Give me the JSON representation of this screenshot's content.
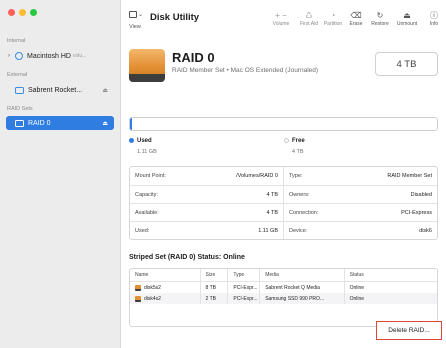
{
  "sidebar": {
    "sections": {
      "internal": "Internal",
      "external": "External",
      "raid_sets": "RAID Sets"
    },
    "items": [
      {
        "label": "Macintosh HD",
        "sub": "volu..."
      },
      {
        "label": "Sabrent Rocket...",
        "eject": "⏏"
      },
      {
        "label": "RAID 0",
        "eject": "⏏"
      }
    ]
  },
  "toolbar": {
    "view_label": "View",
    "title": "Disk Utility",
    "buttons": [
      {
        "icon": "+  −",
        "label": "Volume"
      },
      {
        "icon": "♺",
        "label": "First Aid"
      },
      {
        "icon": "◔",
        "label": "Partition"
      },
      {
        "icon": "⌫",
        "label": "Erase"
      },
      {
        "icon": "↻",
        "label": "Restore"
      },
      {
        "icon": "⏏",
        "label": "Unmount"
      },
      {
        "icon": "ⓘ",
        "label": "Info"
      }
    ]
  },
  "header": {
    "title": "RAID 0",
    "subtitle": "RAID Member Set • Mac OS Extended (Journaled)",
    "size": "4 TB"
  },
  "usage": {
    "used_fraction": 0.0003,
    "used_label": "Used",
    "used_value": "1.11 GB",
    "free_label": "Free",
    "free_value": "4 TB"
  },
  "info": {
    "rows": [
      {
        "l1": "Mount Point:",
        "v1": "/Volumes/RAID 0",
        "l2": "Type:",
        "v2": "RAID Member Set"
      },
      {
        "l1": "Capacity:",
        "v1": "4 TB",
        "l2": "Owners:",
        "v2": "Disabled"
      },
      {
        "l1": "Available:",
        "v1": "4 TB",
        "l2": "Connection:",
        "v2": "PCI-Express"
      },
      {
        "l1": "Used:",
        "v1": "1.11 GB",
        "l2": "Device:",
        "v2": "disk6"
      }
    ]
  },
  "striped": {
    "title": "Striped Set (RAID 0) Status: Online",
    "columns": [
      "Name",
      "Size",
      "Type",
      "Media",
      "Status"
    ],
    "rows": [
      [
        "disk5s2",
        "8 TB",
        "PCI-Expr...",
        "Sabrent Rocket Q Media",
        "Online"
      ],
      [
        "disk4s2",
        "2 TB",
        "PCI-Expr...",
        "Samsung SSD 990 PRO...",
        "Online"
      ]
    ]
  },
  "actions": {
    "delete_label": "Delete RAID..."
  },
  "colors": {
    "accent": "#2f7de1",
    "highlight": "#e0463a"
  }
}
